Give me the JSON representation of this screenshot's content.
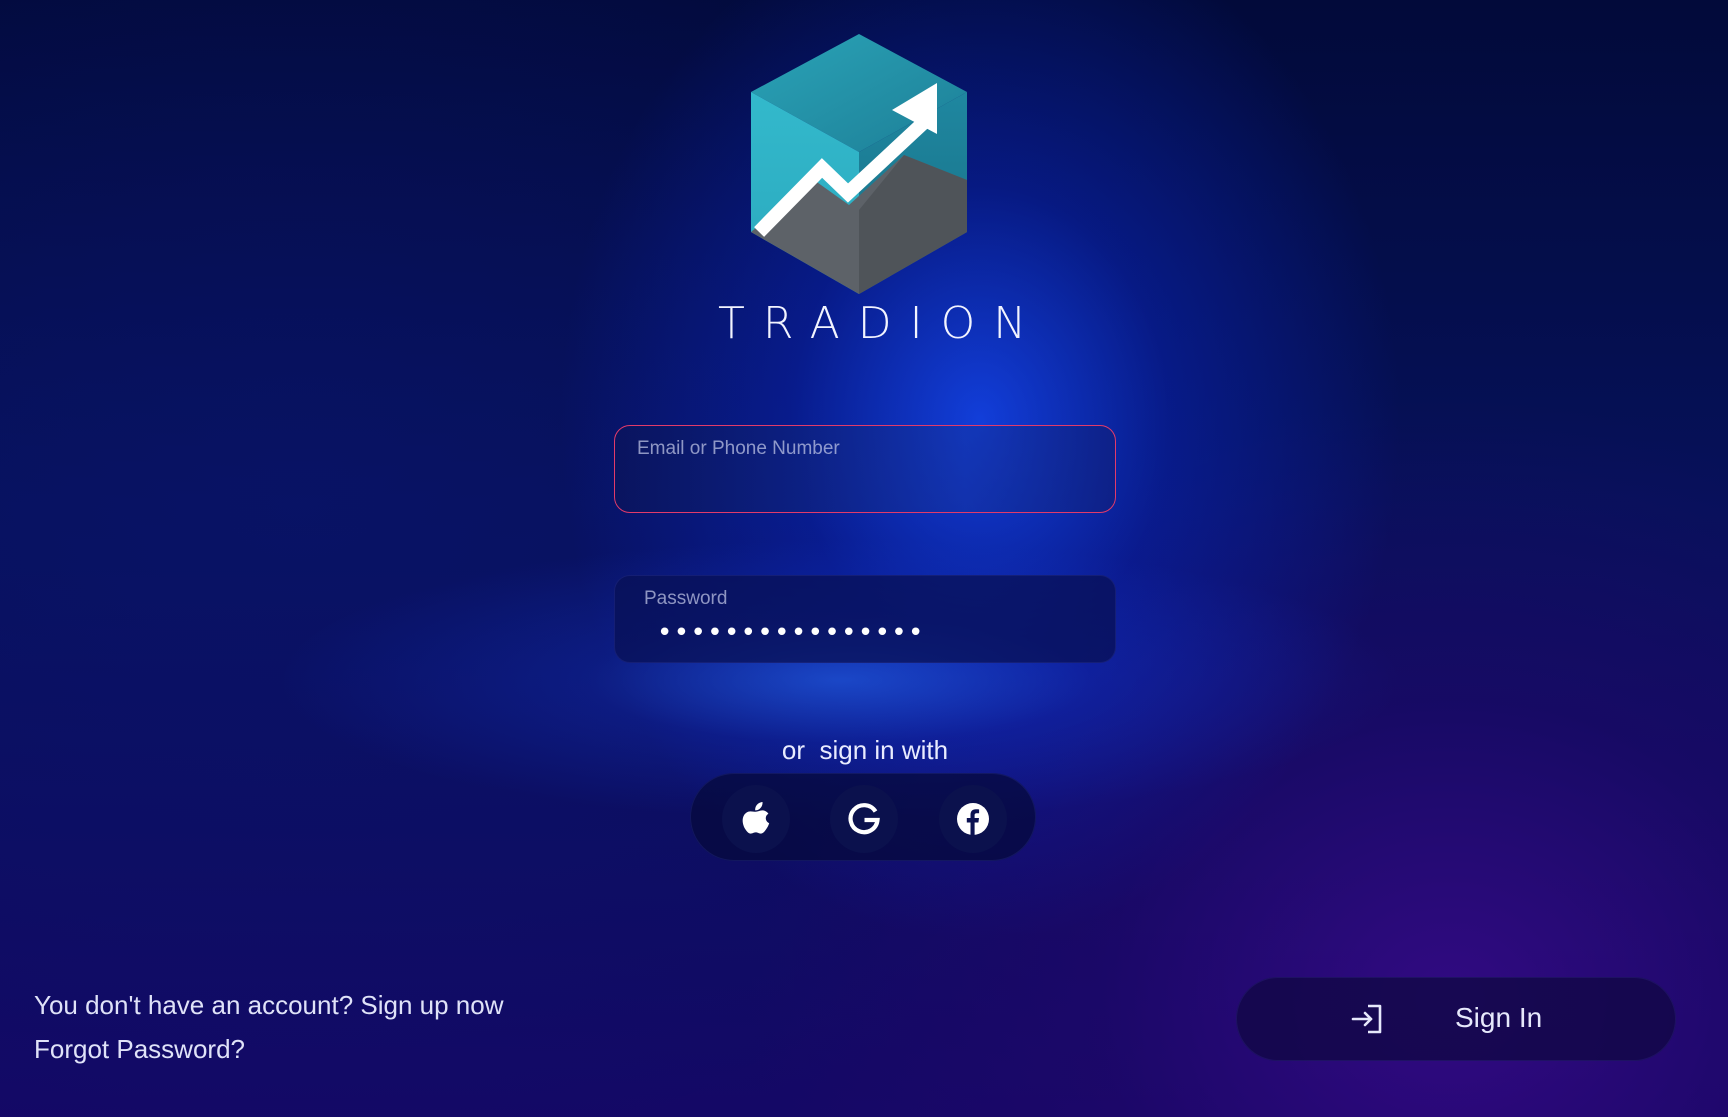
{
  "brand": {
    "name": "TRADION"
  },
  "login_form": {
    "email": {
      "label": "Email or Phone Number",
      "value": ""
    },
    "password": {
      "label": "Password",
      "masked_value": "••••••••••••••••"
    }
  },
  "social": {
    "label": "or  sign in with",
    "providers": [
      {
        "name": "Apple",
        "icon": "apple-icon"
      },
      {
        "name": "Google",
        "icon": "google-icon"
      },
      {
        "name": "Facebook",
        "icon": "facebook-icon"
      }
    ]
  },
  "footer": {
    "signup_text": "You don't have an account? Sign up now",
    "forgot_password": "Forgot Password?"
  },
  "actions": {
    "sign_in_label": "Sign In",
    "sign_in_icon": "login-arrow-icon"
  },
  "colors": {
    "email_border": "#e23a6a",
    "logo_teal": "#2fb3c6",
    "logo_gray": "#5d6268"
  }
}
